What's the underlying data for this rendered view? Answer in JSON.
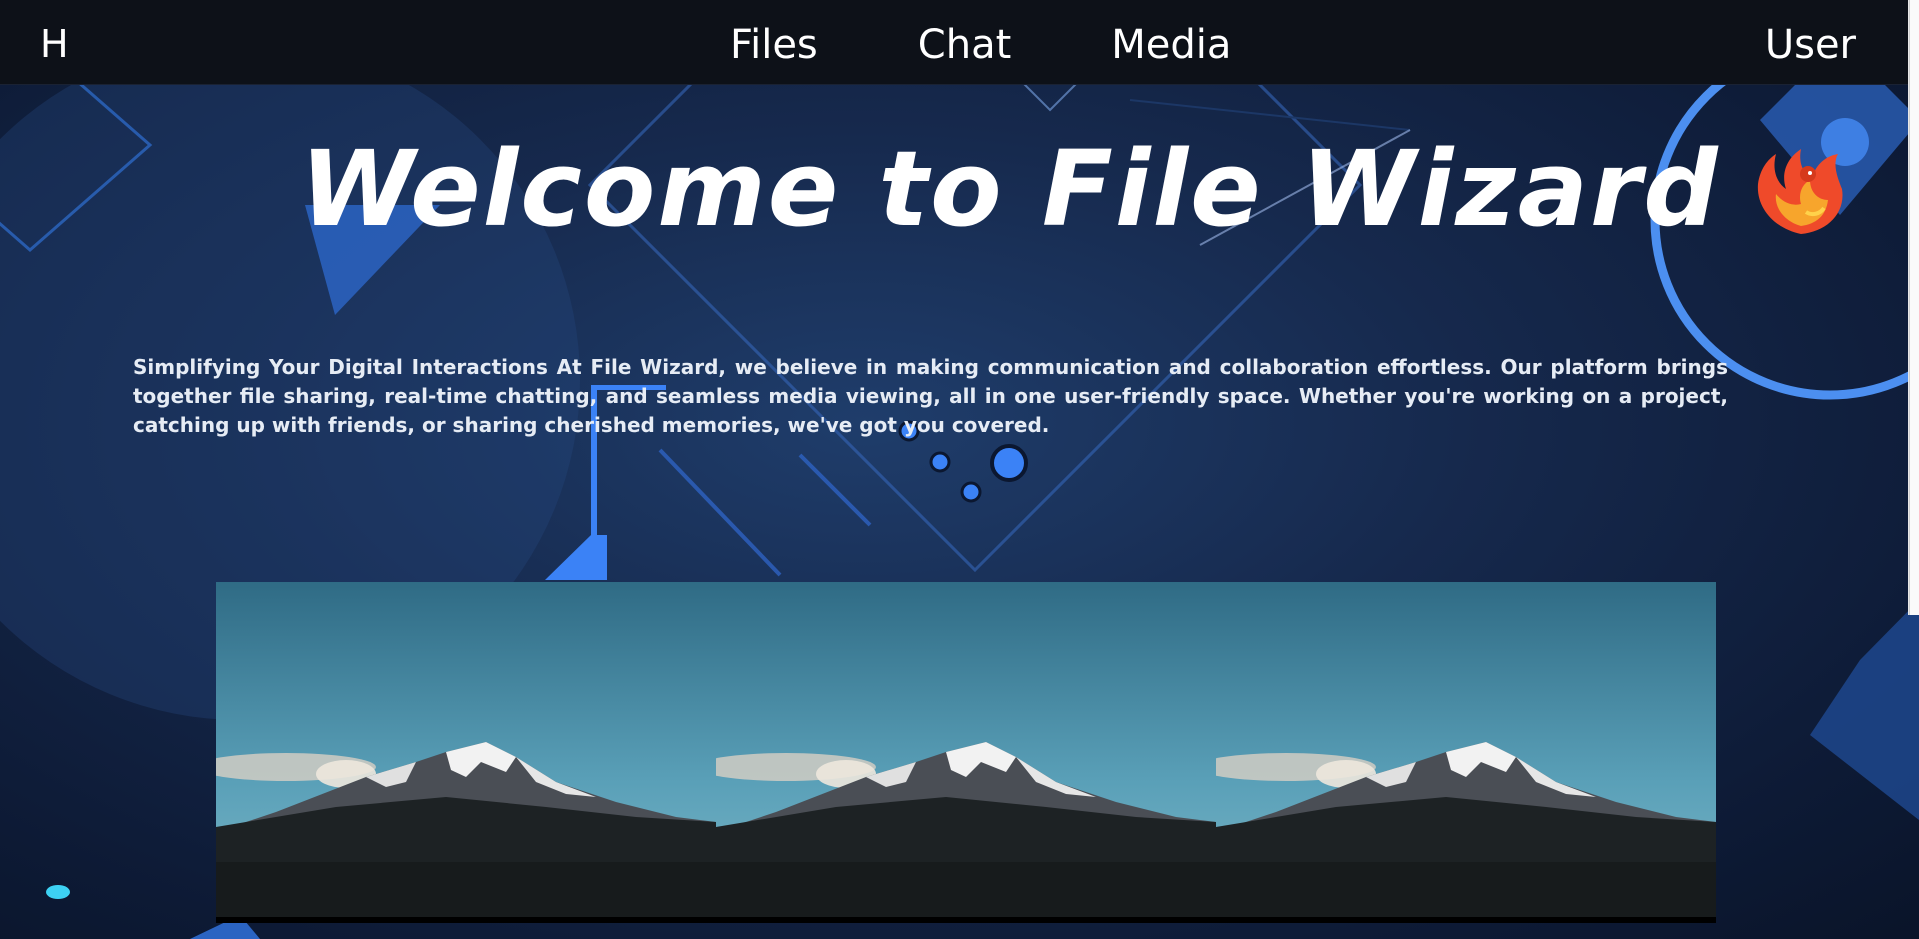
{
  "nav": {
    "logo": "H",
    "links": [
      "Files",
      "Chat",
      "Media"
    ],
    "user": "User"
  },
  "hero": {
    "title": "Welcome to File Wizard",
    "icon": "phoenix-icon"
  },
  "intro": {
    "text": "Simplifying Your Digital Interactions At File Wizard, we believe in making communication and collaboration effortless. Our platform brings together file sharing, real-time chatting, and seamless media viewing, all in one user-friendly space. Whether you're working on a project, catching up with friends, or sharing cherished memories, we've got you covered."
  },
  "gallery": {
    "images": [
      "mountain-photo",
      "mountain-photo",
      "mountain-photo"
    ]
  },
  "colors": {
    "navbar": "#0d1118",
    "background": "#16294d",
    "accent": "#3b82f6"
  }
}
